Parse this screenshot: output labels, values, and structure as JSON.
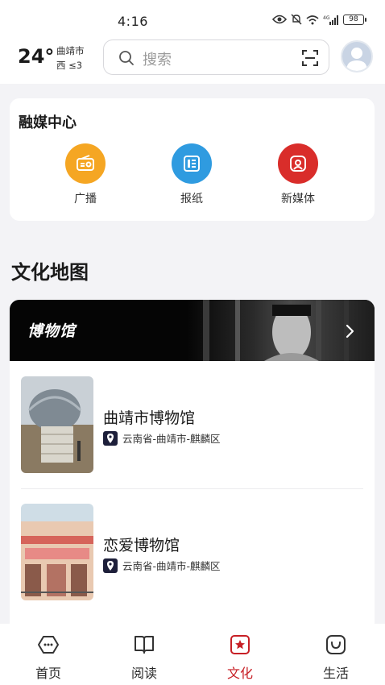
{
  "status_bar": {
    "time": "4:16",
    "network": "4G",
    "battery": "98"
  },
  "weather": {
    "temp": "24°",
    "city": "曲靖市",
    "wind": "西 ≤3"
  },
  "search": {
    "placeholder": "搜索"
  },
  "media_center": {
    "title": "融媒中心",
    "items": [
      {
        "label": "广播",
        "icon": "radio-icon",
        "color": "#f5a623"
      },
      {
        "label": "报纸",
        "icon": "newspaper-icon",
        "color": "#2f9be0"
      },
      {
        "label": "新媒体",
        "icon": "new-media-icon",
        "color": "#d92d2a"
      }
    ]
  },
  "culture_map": {
    "title": "文化地图",
    "banner_title": "博物馆",
    "museums": [
      {
        "name": "曲靖市博物馆",
        "location": "云南省-曲靖市-麒麟区"
      },
      {
        "name": "恋爱博物馆",
        "location": "云南省-曲靖市-麒麟区"
      }
    ]
  },
  "tabbar": {
    "items": [
      {
        "label": "首页",
        "icon": "home-icon"
      },
      {
        "label": "阅读",
        "icon": "book-icon"
      },
      {
        "label": "文化",
        "icon": "culture-icon",
        "active": true
      },
      {
        "label": "生活",
        "icon": "life-icon"
      }
    ],
    "active_color": "#c71f25"
  }
}
